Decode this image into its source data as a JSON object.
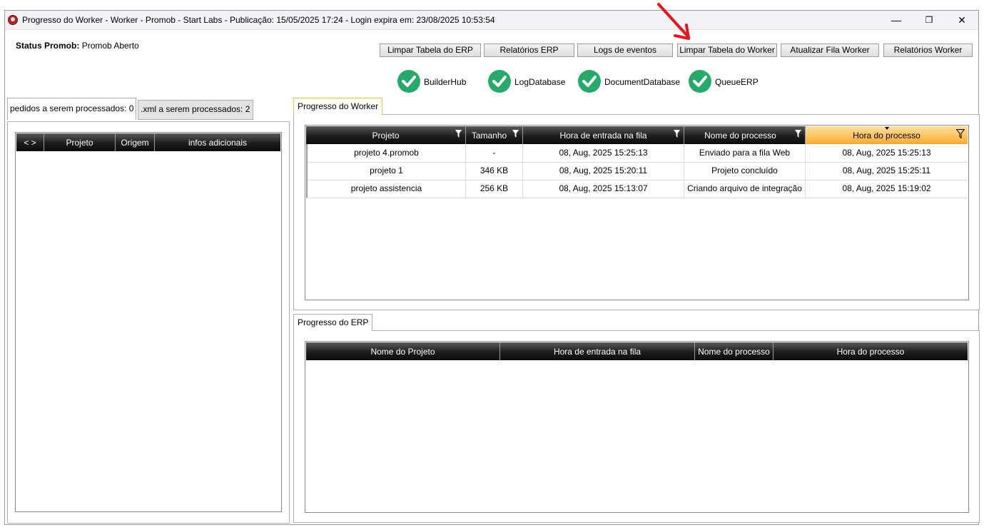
{
  "window": {
    "title": "Progresso do Worker  -  Worker - Promob  -  Start Labs  -  Publicação: 15/05/2025 17:24 - Login expira em: 23/08/2025 10:53:54",
    "minimize": "—",
    "maximize": "❐",
    "close": "✕"
  },
  "status": {
    "label": "Status Promob:",
    "value": "Promob Aberto"
  },
  "toolbar": {
    "limpar_erp": "Limpar Tabela do ERP",
    "relatorios_erp": "Relatórios ERP",
    "logs_eventos": "Logs de eventos",
    "limpar_worker": "Limpar Tabela do Worker",
    "atualizar_fila": "Atualizar Fila Worker",
    "relatorios_worker": "Relatórios Worker"
  },
  "services": [
    {
      "name": "BuilderHub",
      "status": "ok",
      "icon": "check-circle-icon"
    },
    {
      "name": "LogDatabase",
      "status": "ok",
      "icon": "check-circle-icon"
    },
    {
      "name": "DocumentDatabase",
      "status": "ok",
      "icon": "check-circle-icon"
    },
    {
      "name": "QueueERP",
      "status": "ok",
      "icon": "check-circle-icon"
    }
  ],
  "left_tabs": [
    "pedidos a serem processados: 0",
    ".xml a serem processados: 2"
  ],
  "left_grid": {
    "columns": [
      "< >",
      "Projeto",
      "Origem",
      "infos adicionais"
    ],
    "rows": []
  },
  "worker_panel": {
    "tab": "Progresso do Worker",
    "columns": [
      "Projeto",
      "Tamanho",
      "Hora de entrada na fila",
      "Nome do processo",
      "Hora do processo"
    ],
    "rows": [
      [
        "projeto 4.promob",
        "-",
        "08, Aug, 2025 15:25:13",
        "Enviado para a fila Web",
        "08, Aug, 2025 15:25:13"
      ],
      [
        "projeto 1",
        "346 KB",
        "08, Aug, 2025 15:20:11",
        "Projeto concluído",
        "08, Aug, 2025 15:25:11"
      ],
      [
        "projeto assistencia",
        "256 KB",
        "08, Aug, 2025 15:13:07",
        "Criando arquivo de integração",
        "08, Aug, 2025 15:19:02"
      ]
    ]
  },
  "erp_panel": {
    "tab": "Progresso do ERP",
    "columns": [
      "Nome do Projeto",
      "Hora de entrada na fila",
      "Nome do processo",
      "Hora do processo"
    ],
    "rows": []
  },
  "colors": {
    "check": "#27a96b",
    "sorted_header": "#ffc15a",
    "header": "#1d1d1d",
    "annotation_arrow": "#e8141b"
  }
}
